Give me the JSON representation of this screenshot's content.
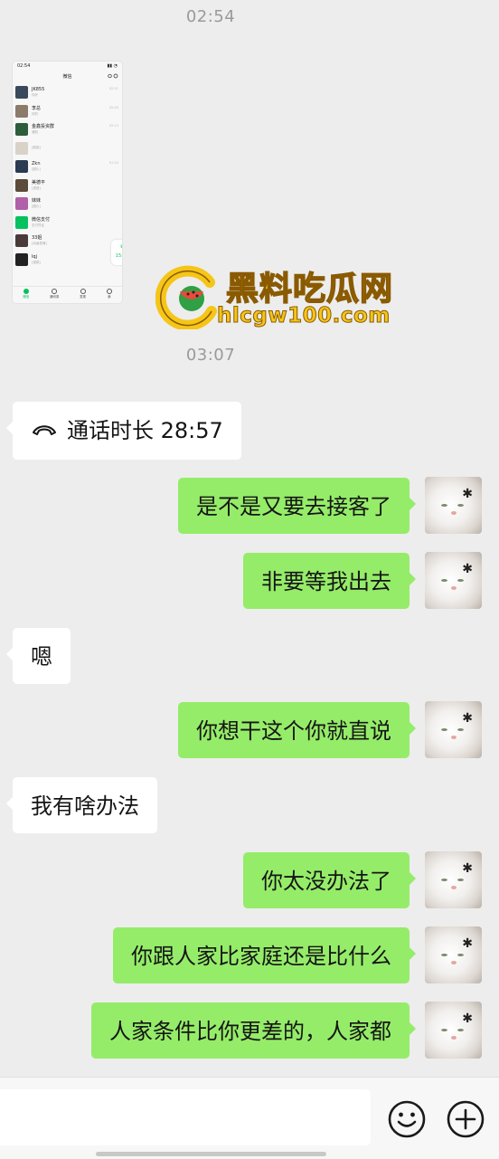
{
  "timestamps": {
    "first": "02:54",
    "second": "03:07"
  },
  "thumbnail": {
    "status_time": "02:54",
    "title": "微信",
    "rows": [
      {
        "name": "JK855",
        "sub": "你好",
        "time": "02:51",
        "color": "#3a4a5c"
      },
      {
        "name": "李总",
        "sub": "好的",
        "time": "02:40",
        "color": "#8c7a6a"
      },
      {
        "name": "金鑫投资群",
        "sub": "通知",
        "time": "02:13",
        "color": "#2c5e3c"
      },
      {
        "name": "",
        "sub": "[链接]",
        "time": "",
        "color": "#d8d2c8"
      },
      {
        "name": "Zkn",
        "sub": "[图片]",
        "time": "01:20",
        "color": "#2a3b52"
      },
      {
        "name": "美德平",
        "sub": "[语音]",
        "time": "",
        "color": "#5c4a3a"
      },
      {
        "name": "妹妹",
        "sub": "[图片]",
        "time": "",
        "color": "#b05fa8"
      },
      {
        "name": "微信支付",
        "sub": "支付凭证",
        "time": "",
        "color": "#07c160"
      },
      {
        "name": "33姐",
        "sub": "[动画表情]",
        "time": "",
        "color": "#4a3a3a"
      },
      {
        "name": "lqj",
        "sub": "[视频]",
        "time": "",
        "color": "#222222"
      }
    ],
    "call_chip": "15:38",
    "tabs": [
      "微信",
      "通讯录",
      "发现",
      "我"
    ]
  },
  "watermark": {
    "line1": "黑料吃瓜网",
    "line2": "hlcgw100.com"
  },
  "messages": {
    "call": "通话时长 28:57",
    "m1": "是不是又要去接客了",
    "m2": "非要等我出去",
    "m3": "嗯",
    "m4": "你想干这个你就直说",
    "m5": "我有啥办法",
    "m6": "你太没办法了",
    "m7": "你跟人家比家庭还是比什么",
    "m8": "人家条件比你更差的，人家都"
  },
  "colors": {
    "outgoing_bubble": "#95ec69",
    "incoming_bubble": "#ffffff",
    "background": "#ededed"
  },
  "icons": {
    "call": "phone-hangup-icon",
    "emoji": "smiley-face-icon",
    "more": "plus-circle-icon"
  }
}
